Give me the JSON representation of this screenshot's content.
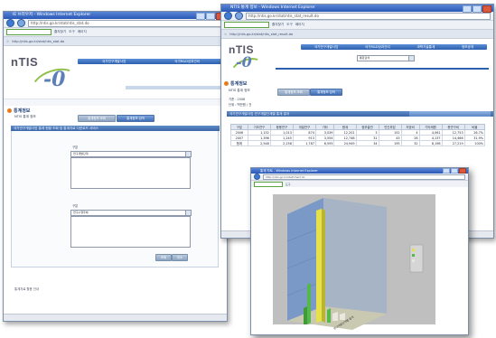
{
  "brand": {
    "logo": "nTIS",
    "swirl": "-0"
  },
  "win1": {
    "title": "IE 브라우저 - Windows Internet Explorer",
    "address": "http://ntis.go.kr/stat/ntis_stat.do",
    "links": [
      "즐겨찾기",
      "도구",
      "페이지"
    ],
    "menu": [
      "국가연구개발사업",
      "국가R&D성과관리"
    ],
    "section_title": "통계정보",
    "breadcrumb": "NTIS 통계 정보",
    "buttons": [
      "통계정보 조회",
      "통계정보 검색"
    ],
    "strip": "국가연구개발사업 통계 현황 조회 및 통계자료 다운로드 서비스",
    "field1_label": "구분",
    "field1_value": "연구개발단계",
    "field2_label": "구분",
    "field2_value": "연구수행주체",
    "footer_buttons": [
      "조회",
      "취소"
    ],
    "footer_link": "통계자료 활용 안내"
  },
  "win2": {
    "title": "NTIS 통계 정보 - Windows Internet Explorer",
    "address": "http://ntis.go.kr/stat/ntis_stat_result.do",
    "menu": [
      "국가연구개발사업",
      "국가R&D성과관리",
      "과학기술통계",
      "정보공개"
    ],
    "search_placeholder": "통합검색",
    "section_title": "통계정보",
    "breadcrumb": "NTIS 통계 정보",
    "buttons": [
      "통계정보 조회",
      "통계정보 검색"
    ],
    "info_lines": [
      "기준 : 2008",
      "단위 : 백만원 / 건"
    ],
    "strip": "국가연구개발사업 연구개발단계별 통계 결과",
    "table": {
      "headers": [
        "구분",
        "기초연구",
        "응용연구",
        "개발연구",
        "기타",
        "합계",
        "정부출연",
        "민간부담",
        "지방비",
        "기타재원",
        "총연구비",
        "비율"
      ],
      "rows": [
        [
          "2006",
          "1,152",
          "1,013",
          "874",
          "3,039",
          "12,201",
          "3",
          "152",
          "4",
          "4,061",
          "12,753",
          "26.7%"
        ],
        [
          "2007",
          "1,396",
          "1,245",
          "913",
          "3,554",
          "12,748",
          "31",
          "43",
          "28",
          "4,137",
          "14,466",
          "31.9%"
        ],
        [
          "합계",
          "2,548",
          "2,258",
          "1,787",
          "6,593",
          "24,949",
          "34",
          "195",
          "32",
          "8,198",
          "27,219",
          "100%"
        ]
      ]
    }
  },
  "win3": {
    "title": "통계 차트 - Windows Internet Explorer",
    "address": "http://ntis.go.kr/stat/chart.do",
    "chart_caption": "연구개발단계별 통계"
  }
}
